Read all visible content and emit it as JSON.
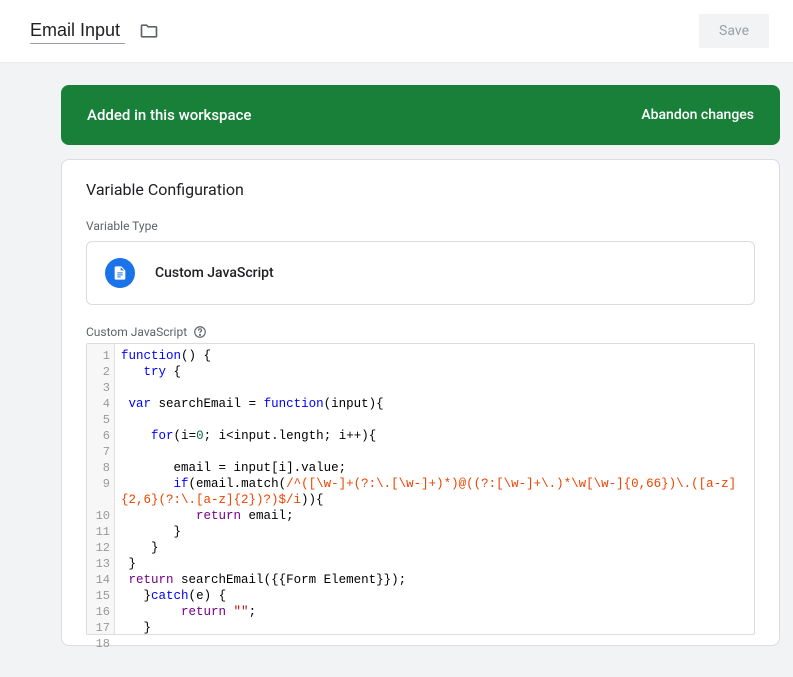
{
  "header": {
    "title_value": "Email Input",
    "save_label": "Save"
  },
  "banner": {
    "status_text": "Added in this workspace",
    "abandon_label": "Abandon changes"
  },
  "config": {
    "card_title": "Variable Configuration",
    "type_label": "Variable Type",
    "type_name": "Custom JavaScript",
    "code_label": "Custom JavaScript"
  },
  "code": {
    "lines": [
      "1",
      "2",
      "3",
      "4",
      "5",
      "6",
      "7",
      "8",
      "9",
      "10",
      "11",
      "12",
      "13",
      "14",
      "15",
      "16",
      "17",
      "18"
    ],
    "kw_function": "function",
    "kw_try": "try",
    "kw_var": "var",
    "kw_for": "for",
    "kw_if": "if",
    "kw_return": "return",
    "kw_catch": "catch",
    "id_searchEmail": "searchEmail",
    "id_input": "input",
    "id_i": "i",
    "id_email": "email",
    "id_length": "length",
    "id_value": "value",
    "id_match": "match",
    "id_e": "e",
    "num_0": "0",
    "regex": "/^([\\w-]+(?:\\.[\\w-]+)*)@((?:[\\w-]+\\.)*\\w[\\w-]{0,66})\\.([a-z]{2,6}(?:\\.[a-z]{2})?)$/i",
    "form_element": "{{Form Element}}",
    "empty_str": "\"\""
  }
}
